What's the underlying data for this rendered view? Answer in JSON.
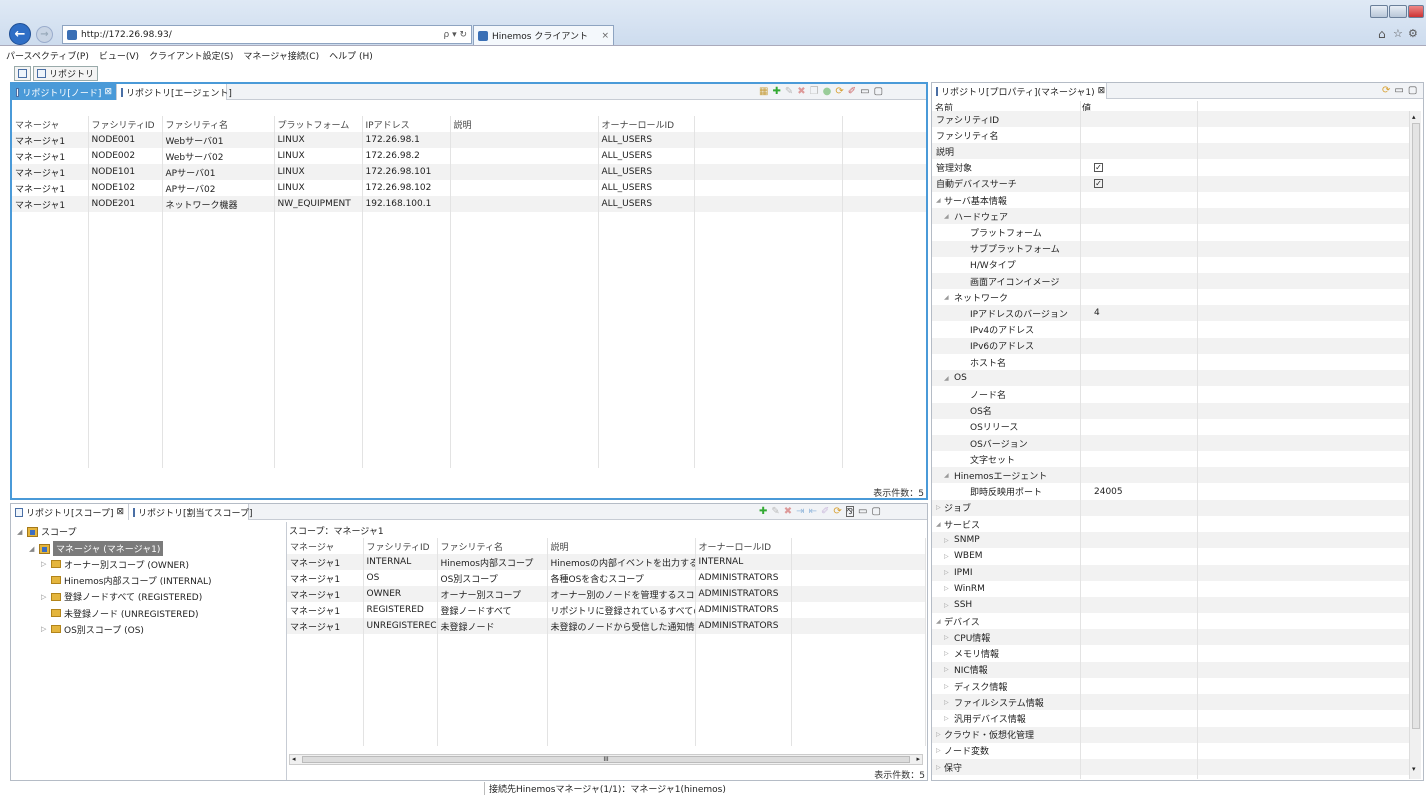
{
  "browser": {
    "url": "http://172.26.98.93/",
    "search_hint": "ρ ▾ ↻",
    "tab_title": "Hinemos クライアント"
  },
  "menu": [
    "パースペクティブ(P)",
    "ビュー(V)",
    "クライアント設定(S)",
    "マネージャ接続(C)",
    "ヘルプ (H)"
  ],
  "toolbar": {
    "repo_button": "リポジトリ"
  },
  "node_pane": {
    "tabs": [
      "リポジトリ[ノード]",
      "リポジトリ[エージェント]"
    ],
    "headers": [
      "マネージャ",
      "ファシリティID",
      "ファシリティ名",
      "プラットフォーム",
      "IPアドレス",
      "説明",
      "オーナーロールID"
    ],
    "rows": [
      [
        "マネージャ1",
        "NODE001",
        "Webサーバ01",
        "LINUX",
        "172.26.98.1",
        "",
        "ALL_USERS"
      ],
      [
        "マネージャ1",
        "NODE002",
        "Webサーバ02",
        "LINUX",
        "172.26.98.2",
        "",
        "ALL_USERS"
      ],
      [
        "マネージャ1",
        "NODE101",
        "APサーバ01",
        "LINUX",
        "172.26.98.101",
        "",
        "ALL_USERS"
      ],
      [
        "マネージャ1",
        "NODE102",
        "APサーバ02",
        "LINUX",
        "172.26.98.102",
        "",
        "ALL_USERS"
      ],
      [
        "マネージャ1",
        "NODE201",
        "ネットワーク機器",
        "NW_EQUIPMENT",
        "192.168.100.1",
        "",
        "ALL_USERS"
      ]
    ],
    "count": "表示件数：5"
  },
  "scope_pane": {
    "tabs": [
      "リポジトリ[スコープ]",
      "リポジトリ[割当てスコープ]"
    ],
    "tree": [
      {
        "label": "スコープ",
        "level": 0,
        "arrow": "◢"
      },
      {
        "label": "マネージャ (マネージャ1)",
        "level": 1,
        "arrow": "◢"
      },
      {
        "label": "オーナー別スコープ (OWNER)",
        "level": 2,
        "arrow": "▷"
      },
      {
        "label": "Hinemos内部スコープ (INTERNAL)",
        "level": 2,
        "arrow": ""
      },
      {
        "label": "登録ノードすべて (REGISTERED)",
        "level": 2,
        "arrow": "▷"
      },
      {
        "label": "未登録ノード (UNREGISTERED)",
        "level": 2,
        "arrow": ""
      },
      {
        "label": "OS別スコープ (OS)",
        "level": 2,
        "arrow": "▷"
      }
    ],
    "scope_label": "スコープ：マネージャ1",
    "headers": [
      "マネージャ",
      "ファシリティID",
      "ファシリティ名",
      "説明",
      "オーナーロールID"
    ],
    "rows": [
      [
        "マネージャ1",
        "INTERNAL",
        "Hinemos内部スコープ",
        "Hinemosの内部イベントを出力するス",
        "INTERNAL"
      ],
      [
        "マネージャ1",
        "OS",
        "OS別スコープ",
        "各種OSを含むスコープ",
        "ADMINISTRATORS"
      ],
      [
        "マネージャ1",
        "OWNER",
        "オーナー別スコープ",
        "オーナー別のノードを管理するスコープ",
        "ADMINISTRATORS"
      ],
      [
        "マネージャ1",
        "REGISTERED",
        "登録ノードすべて",
        "リポジトリに登録されているすべてのノ",
        "ADMINISTRATORS"
      ],
      [
        "マネージャ1",
        "UNREGISTEREC",
        "未登録ノード",
        "未登録のノードから受信した通知情報を",
        "ADMINISTRATORS"
      ]
    ],
    "scroll_mid": "III",
    "count": "表示件数：5"
  },
  "prop_pane": {
    "tab": "リポジトリ[プロパティ](マネージャ1)",
    "header_name": "名前",
    "header_value": "値",
    "rows": [
      {
        "n": "ファシリティID",
        "l": 0,
        "a": ""
      },
      {
        "n": "ファシリティ名",
        "l": 0,
        "a": ""
      },
      {
        "n": "説明",
        "l": 0,
        "a": ""
      },
      {
        "n": "管理対象",
        "l": 0,
        "a": "",
        "chk": "✓"
      },
      {
        "n": "自動デバイスサーチ",
        "l": 0,
        "a": "",
        "chk": "✓"
      },
      {
        "n": "サーバ基本情報",
        "l": 0,
        "a": "◢"
      },
      {
        "n": "ハードウェア",
        "l": 1,
        "a": "◢"
      },
      {
        "n": "プラットフォーム",
        "l": 3,
        "a": ""
      },
      {
        "n": "サブプラットフォーム",
        "l": 3,
        "a": ""
      },
      {
        "n": "H/Wタイプ",
        "l": 3,
        "a": ""
      },
      {
        "n": "画面アイコンイメージ",
        "l": 3,
        "a": ""
      },
      {
        "n": "ネットワーク",
        "l": 1,
        "a": "◢"
      },
      {
        "n": "IPアドレスのバージョン",
        "l": 3,
        "a": "",
        "v": "4"
      },
      {
        "n": "IPv4のアドレス",
        "l": 3,
        "a": ""
      },
      {
        "n": "IPv6のアドレス",
        "l": 3,
        "a": ""
      },
      {
        "n": "ホスト名",
        "l": 3,
        "a": ""
      },
      {
        "n": "OS",
        "l": 1,
        "a": "◢"
      },
      {
        "n": "ノード名",
        "l": 3,
        "a": ""
      },
      {
        "n": "OS名",
        "l": 3,
        "a": ""
      },
      {
        "n": "OSリリース",
        "l": 3,
        "a": ""
      },
      {
        "n": "OSバージョン",
        "l": 3,
        "a": ""
      },
      {
        "n": "文字セット",
        "l": 3,
        "a": ""
      },
      {
        "n": "Hinemosエージェント",
        "l": 1,
        "a": "◢"
      },
      {
        "n": "即時反映用ポート",
        "l": 3,
        "a": "",
        "v": "24005"
      },
      {
        "n": "ジョブ",
        "l": 0,
        "a": "▷"
      },
      {
        "n": "サービス",
        "l": 0,
        "a": "◢"
      },
      {
        "n": "SNMP",
        "l": 1,
        "a": "▷"
      },
      {
        "n": "WBEM",
        "l": 1,
        "a": "▷"
      },
      {
        "n": "IPMI",
        "l": 1,
        "a": "▷"
      },
      {
        "n": "WinRM",
        "l": 1,
        "a": "▷"
      },
      {
        "n": "SSH",
        "l": 1,
        "a": "▷"
      },
      {
        "n": "デバイス",
        "l": 0,
        "a": "◢"
      },
      {
        "n": "CPU情報",
        "l": 1,
        "a": "▷"
      },
      {
        "n": "メモリ情報",
        "l": 1,
        "a": "▷"
      },
      {
        "n": "NIC情報",
        "l": 1,
        "a": "▷"
      },
      {
        "n": "ディスク情報",
        "l": 1,
        "a": "▷"
      },
      {
        "n": "ファイルシステム情報",
        "l": 1,
        "a": "▷"
      },
      {
        "n": "汎用デバイス情報",
        "l": 1,
        "a": "▷"
      },
      {
        "n": "クラウド・仮想化管理",
        "l": 0,
        "a": "▷"
      },
      {
        "n": "ノード変数",
        "l": 0,
        "a": "▷"
      },
      {
        "n": "保守",
        "l": 0,
        "a": "▷"
      }
    ]
  },
  "status": "接続先Hinemosマネージャ(1/1)：マネージャ1(hinemos)",
  "colors": {
    "accent": "#4a9ad8",
    "selected_tree": "#7b7b7b"
  }
}
